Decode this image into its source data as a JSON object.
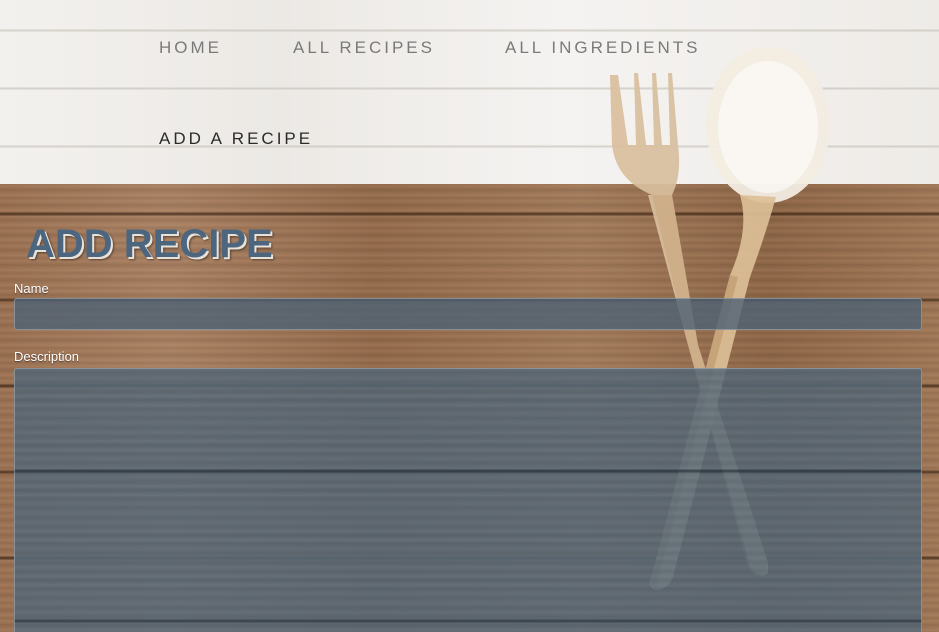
{
  "nav": {
    "items": [
      {
        "label": "HOME"
      },
      {
        "label": "ALL RECIPES"
      },
      {
        "label": "ALL INGREDIENTS"
      },
      {
        "label": "ADD A RECIPE"
      }
    ]
  },
  "form": {
    "title": "ADD RECIPE",
    "name_label": "Name",
    "name_value": "",
    "description_label": "Description",
    "description_value": ""
  },
  "colors": {
    "title": "#4d6680",
    "field_background": "#4e6276",
    "header_background": "#f1efec",
    "wood": "#9b7150"
  }
}
